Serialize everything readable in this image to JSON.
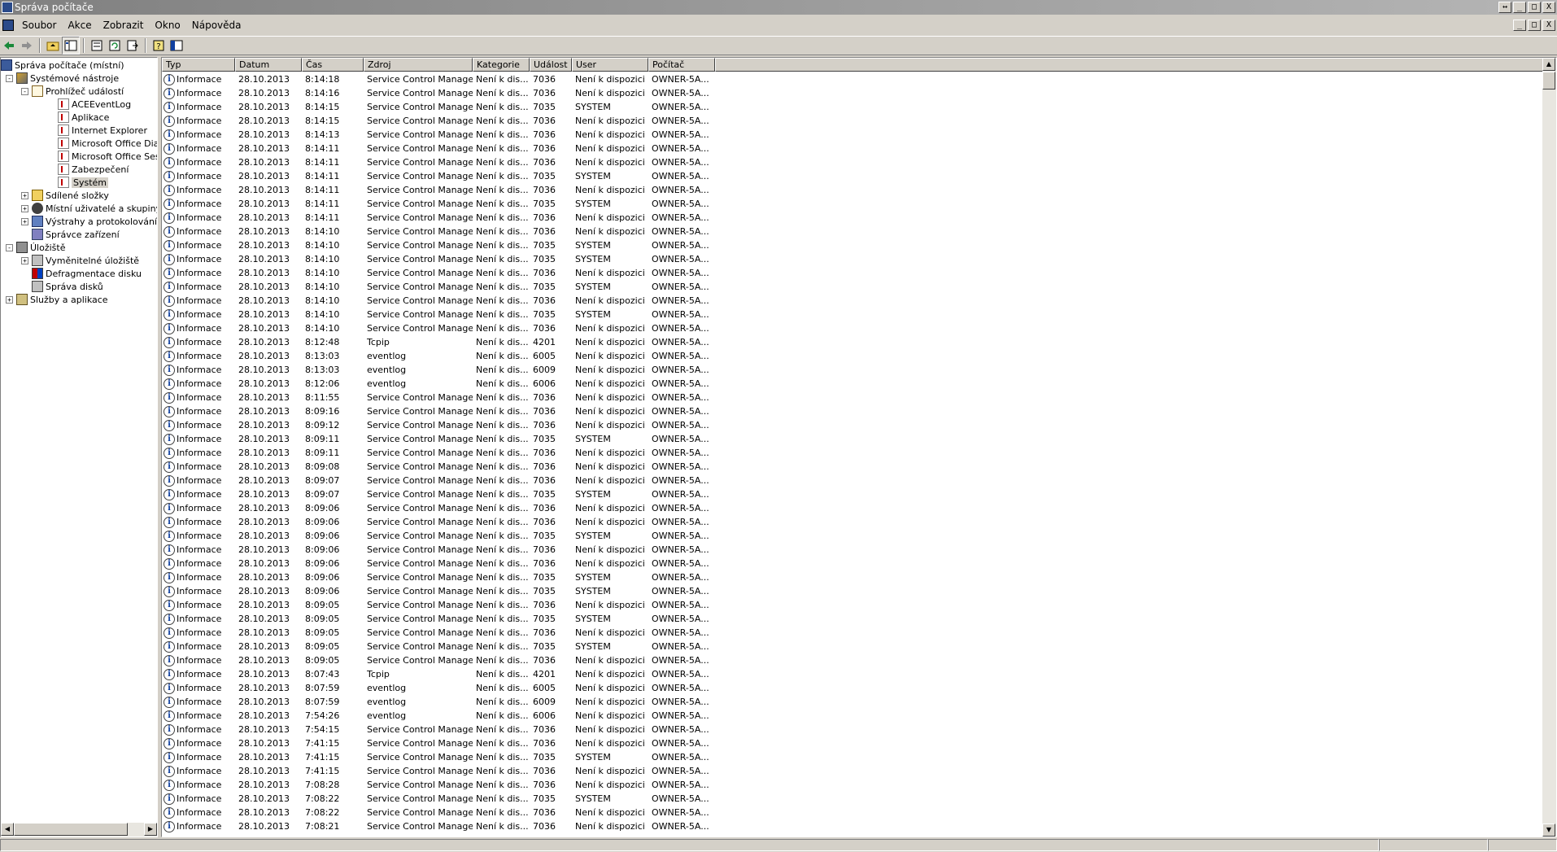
{
  "window": {
    "title": "Správa počítače",
    "buttons": [
      "↔",
      "_",
      "□",
      "X"
    ],
    "mdi_buttons": [
      "_",
      "□",
      "X"
    ]
  },
  "menu": [
    "Soubor",
    "Akce",
    "Zobrazit",
    "Okno",
    "Nápověda"
  ],
  "toolbar": [
    "back-icon",
    "forward-icon",
    "up-folder-icon",
    "show-tree-icon",
    "properties-icon",
    "refresh-icon",
    "export-icon",
    "help-icon",
    "console-icon"
  ],
  "tree": [
    {
      "label": "Správa počítače (místní)",
      "level": 0,
      "toggle": "",
      "icon": "comp"
    },
    {
      "label": "Systémové nástroje",
      "level": 1,
      "toggle": "-",
      "icon": "tools"
    },
    {
      "label": "Prohlížeč událostí",
      "level": 2,
      "toggle": "-",
      "icon": "ev"
    },
    {
      "label": "ACEEventLog",
      "level": 3,
      "toggle": "",
      "icon": "log"
    },
    {
      "label": "Aplikace",
      "level": 3,
      "toggle": "",
      "icon": "log"
    },
    {
      "label": "Internet Explorer",
      "level": 3,
      "toggle": "",
      "icon": "log"
    },
    {
      "label": "Microsoft Office Diagnos",
      "level": 3,
      "toggle": "",
      "icon": "log"
    },
    {
      "label": "Microsoft Office Session",
      "level": 3,
      "toggle": "",
      "icon": "log"
    },
    {
      "label": "Zabezpečení",
      "level": 3,
      "toggle": "",
      "icon": "log"
    },
    {
      "label": "Systém",
      "level": 3,
      "toggle": "",
      "icon": "log",
      "selected": true
    },
    {
      "label": "Sdílené složky",
      "level": 2,
      "toggle": "+",
      "icon": "folder"
    },
    {
      "label": "Místní uživatelé a skupiny",
      "level": 2,
      "toggle": "+",
      "icon": "users"
    },
    {
      "label": "Výstrahy a protokolování vý",
      "level": 2,
      "toggle": "+",
      "icon": "perf"
    },
    {
      "label": "Správce zařízení",
      "level": 2,
      "toggle": "",
      "icon": "dev"
    },
    {
      "label": "Úložiště",
      "level": 1,
      "toggle": "-",
      "icon": "stor"
    },
    {
      "label": "Vyměnitelné úložiště",
      "level": 2,
      "toggle": "+",
      "icon": "drive"
    },
    {
      "label": "Defragmentace disku",
      "level": 2,
      "toggle": "",
      "icon": "defrag"
    },
    {
      "label": "Správa disků",
      "level": 2,
      "toggle": "",
      "icon": "drive"
    },
    {
      "label": "Služby a aplikace",
      "level": 1,
      "toggle": "+",
      "icon": "svc"
    }
  ],
  "columns": [
    "Typ",
    "Datum",
    "Čas",
    "Zdroj",
    "Kategorie",
    "Událost",
    "User",
    "Počítač"
  ],
  "events": [
    [
      "Informace",
      "28.10.2013",
      "8:14:18",
      "Service Control Manager",
      "Není k dis...",
      "7036",
      "Není k dispozici",
      "OWNER-5A..."
    ],
    [
      "Informace",
      "28.10.2013",
      "8:14:16",
      "Service Control Manager",
      "Není k dis...",
      "7036",
      "Není k dispozici",
      "OWNER-5A..."
    ],
    [
      "Informace",
      "28.10.2013",
      "8:14:15",
      "Service Control Manager",
      "Není k dis...",
      "7035",
      "SYSTEM",
      "OWNER-5A..."
    ],
    [
      "Informace",
      "28.10.2013",
      "8:14:15",
      "Service Control Manager",
      "Není k dis...",
      "7036",
      "Není k dispozici",
      "OWNER-5A..."
    ],
    [
      "Informace",
      "28.10.2013",
      "8:14:13",
      "Service Control Manager",
      "Není k dis...",
      "7036",
      "Není k dispozici",
      "OWNER-5A..."
    ],
    [
      "Informace",
      "28.10.2013",
      "8:14:11",
      "Service Control Manager",
      "Není k dis...",
      "7036",
      "Není k dispozici",
      "OWNER-5A..."
    ],
    [
      "Informace",
      "28.10.2013",
      "8:14:11",
      "Service Control Manager",
      "Není k dis...",
      "7036",
      "Není k dispozici",
      "OWNER-5A..."
    ],
    [
      "Informace",
      "28.10.2013",
      "8:14:11",
      "Service Control Manager",
      "Není k dis...",
      "7035",
      "SYSTEM",
      "OWNER-5A..."
    ],
    [
      "Informace",
      "28.10.2013",
      "8:14:11",
      "Service Control Manager",
      "Není k dis...",
      "7036",
      "Není k dispozici",
      "OWNER-5A..."
    ],
    [
      "Informace",
      "28.10.2013",
      "8:14:11",
      "Service Control Manager",
      "Není k dis...",
      "7035",
      "SYSTEM",
      "OWNER-5A..."
    ],
    [
      "Informace",
      "28.10.2013",
      "8:14:11",
      "Service Control Manager",
      "Není k dis...",
      "7036",
      "Není k dispozici",
      "OWNER-5A..."
    ],
    [
      "Informace",
      "28.10.2013",
      "8:14:10",
      "Service Control Manager",
      "Není k dis...",
      "7036",
      "Není k dispozici",
      "OWNER-5A..."
    ],
    [
      "Informace",
      "28.10.2013",
      "8:14:10",
      "Service Control Manager",
      "Není k dis...",
      "7035",
      "SYSTEM",
      "OWNER-5A..."
    ],
    [
      "Informace",
      "28.10.2013",
      "8:14:10",
      "Service Control Manager",
      "Není k dis...",
      "7035",
      "SYSTEM",
      "OWNER-5A..."
    ],
    [
      "Informace",
      "28.10.2013",
      "8:14:10",
      "Service Control Manager",
      "Není k dis...",
      "7036",
      "Není k dispozici",
      "OWNER-5A..."
    ],
    [
      "Informace",
      "28.10.2013",
      "8:14:10",
      "Service Control Manager",
      "Není k dis...",
      "7035",
      "SYSTEM",
      "OWNER-5A..."
    ],
    [
      "Informace",
      "28.10.2013",
      "8:14:10",
      "Service Control Manager",
      "Není k dis...",
      "7036",
      "Není k dispozici",
      "OWNER-5A..."
    ],
    [
      "Informace",
      "28.10.2013",
      "8:14:10",
      "Service Control Manager",
      "Není k dis...",
      "7035",
      "SYSTEM",
      "OWNER-5A..."
    ],
    [
      "Informace",
      "28.10.2013",
      "8:14:10",
      "Service Control Manager",
      "Není k dis...",
      "7036",
      "Není k dispozici",
      "OWNER-5A..."
    ],
    [
      "Informace",
      "28.10.2013",
      "8:12:48",
      "Tcpip",
      "Není k dis...",
      "4201",
      "Není k dispozici",
      "OWNER-5A..."
    ],
    [
      "Informace",
      "28.10.2013",
      "8:13:03",
      "eventlog",
      "Není k dis...",
      "6005",
      "Není k dispozici",
      "OWNER-5A..."
    ],
    [
      "Informace",
      "28.10.2013",
      "8:13:03",
      "eventlog",
      "Není k dis...",
      "6009",
      "Není k dispozici",
      "OWNER-5A..."
    ],
    [
      "Informace",
      "28.10.2013",
      "8:12:06",
      "eventlog",
      "Není k dis...",
      "6006",
      "Není k dispozici",
      "OWNER-5A..."
    ],
    [
      "Informace",
      "28.10.2013",
      "8:11:55",
      "Service Control Manager",
      "Není k dis...",
      "7036",
      "Není k dispozici",
      "OWNER-5A..."
    ],
    [
      "Informace",
      "28.10.2013",
      "8:09:16",
      "Service Control Manager",
      "Není k dis...",
      "7036",
      "Není k dispozici",
      "OWNER-5A..."
    ],
    [
      "Informace",
      "28.10.2013",
      "8:09:12",
      "Service Control Manager",
      "Není k dis...",
      "7036",
      "Není k dispozici",
      "OWNER-5A..."
    ],
    [
      "Informace",
      "28.10.2013",
      "8:09:11",
      "Service Control Manager",
      "Není k dis...",
      "7035",
      "SYSTEM",
      "OWNER-5A..."
    ],
    [
      "Informace",
      "28.10.2013",
      "8:09:11",
      "Service Control Manager",
      "Není k dis...",
      "7036",
      "Není k dispozici",
      "OWNER-5A..."
    ],
    [
      "Informace",
      "28.10.2013",
      "8:09:08",
      "Service Control Manager",
      "Není k dis...",
      "7036",
      "Není k dispozici",
      "OWNER-5A..."
    ],
    [
      "Informace",
      "28.10.2013",
      "8:09:07",
      "Service Control Manager",
      "Není k dis...",
      "7036",
      "Není k dispozici",
      "OWNER-5A..."
    ],
    [
      "Informace",
      "28.10.2013",
      "8:09:07",
      "Service Control Manager",
      "Není k dis...",
      "7035",
      "SYSTEM",
      "OWNER-5A..."
    ],
    [
      "Informace",
      "28.10.2013",
      "8:09:06",
      "Service Control Manager",
      "Není k dis...",
      "7036",
      "Není k dispozici",
      "OWNER-5A..."
    ],
    [
      "Informace",
      "28.10.2013",
      "8:09:06",
      "Service Control Manager",
      "Není k dis...",
      "7036",
      "Není k dispozici",
      "OWNER-5A..."
    ],
    [
      "Informace",
      "28.10.2013",
      "8:09:06",
      "Service Control Manager",
      "Není k dis...",
      "7035",
      "SYSTEM",
      "OWNER-5A..."
    ],
    [
      "Informace",
      "28.10.2013",
      "8:09:06",
      "Service Control Manager",
      "Není k dis...",
      "7036",
      "Není k dispozici",
      "OWNER-5A..."
    ],
    [
      "Informace",
      "28.10.2013",
      "8:09:06",
      "Service Control Manager",
      "Není k dis...",
      "7036",
      "Není k dispozici",
      "OWNER-5A..."
    ],
    [
      "Informace",
      "28.10.2013",
      "8:09:06",
      "Service Control Manager",
      "Není k dis...",
      "7035",
      "SYSTEM",
      "OWNER-5A..."
    ],
    [
      "Informace",
      "28.10.2013",
      "8:09:06",
      "Service Control Manager",
      "Není k dis...",
      "7035",
      "SYSTEM",
      "OWNER-5A..."
    ],
    [
      "Informace",
      "28.10.2013",
      "8:09:05",
      "Service Control Manager",
      "Není k dis...",
      "7036",
      "Není k dispozici",
      "OWNER-5A..."
    ],
    [
      "Informace",
      "28.10.2013",
      "8:09:05",
      "Service Control Manager",
      "Není k dis...",
      "7035",
      "SYSTEM",
      "OWNER-5A..."
    ],
    [
      "Informace",
      "28.10.2013",
      "8:09:05",
      "Service Control Manager",
      "Není k dis...",
      "7036",
      "Není k dispozici",
      "OWNER-5A..."
    ],
    [
      "Informace",
      "28.10.2013",
      "8:09:05",
      "Service Control Manager",
      "Není k dis...",
      "7035",
      "SYSTEM",
      "OWNER-5A..."
    ],
    [
      "Informace",
      "28.10.2013",
      "8:09:05",
      "Service Control Manager",
      "Není k dis...",
      "7036",
      "Není k dispozici",
      "OWNER-5A..."
    ],
    [
      "Informace",
      "28.10.2013",
      "8:07:43",
      "Tcpip",
      "Není k dis...",
      "4201",
      "Není k dispozici",
      "OWNER-5A..."
    ],
    [
      "Informace",
      "28.10.2013",
      "8:07:59",
      "eventlog",
      "Není k dis...",
      "6005",
      "Není k dispozici",
      "OWNER-5A..."
    ],
    [
      "Informace",
      "28.10.2013",
      "8:07:59",
      "eventlog",
      "Není k dis...",
      "6009",
      "Není k dispozici",
      "OWNER-5A..."
    ],
    [
      "Informace",
      "28.10.2013",
      "7:54:26",
      "eventlog",
      "Není k dis...",
      "6006",
      "Není k dispozici",
      "OWNER-5A..."
    ],
    [
      "Informace",
      "28.10.2013",
      "7:54:15",
      "Service Control Manager",
      "Není k dis...",
      "7036",
      "Není k dispozici",
      "OWNER-5A..."
    ],
    [
      "Informace",
      "28.10.2013",
      "7:41:15",
      "Service Control Manager",
      "Není k dis...",
      "7036",
      "Není k dispozici",
      "OWNER-5A..."
    ],
    [
      "Informace",
      "28.10.2013",
      "7:41:15",
      "Service Control Manager",
      "Není k dis...",
      "7035",
      "SYSTEM",
      "OWNER-5A..."
    ],
    [
      "Informace",
      "28.10.2013",
      "7:41:15",
      "Service Control Manager",
      "Není k dis...",
      "7036",
      "Není k dispozici",
      "OWNER-5A..."
    ],
    [
      "Informace",
      "28.10.2013",
      "7:08:28",
      "Service Control Manager",
      "Není k dis...",
      "7036",
      "Není k dispozici",
      "OWNER-5A..."
    ],
    [
      "Informace",
      "28.10.2013",
      "7:08:22",
      "Service Control Manager",
      "Není k dis...",
      "7035",
      "SYSTEM",
      "OWNER-5A..."
    ],
    [
      "Informace",
      "28.10.2013",
      "7:08:22",
      "Service Control Manager",
      "Není k dis...",
      "7036",
      "Není k dispozici",
      "OWNER-5A..."
    ],
    [
      "Informace",
      "28.10.2013",
      "7:08:21",
      "Service Control Manager",
      "Není k dis...",
      "7036",
      "Není k dispozici",
      "OWNER-5A..."
    ]
  ]
}
